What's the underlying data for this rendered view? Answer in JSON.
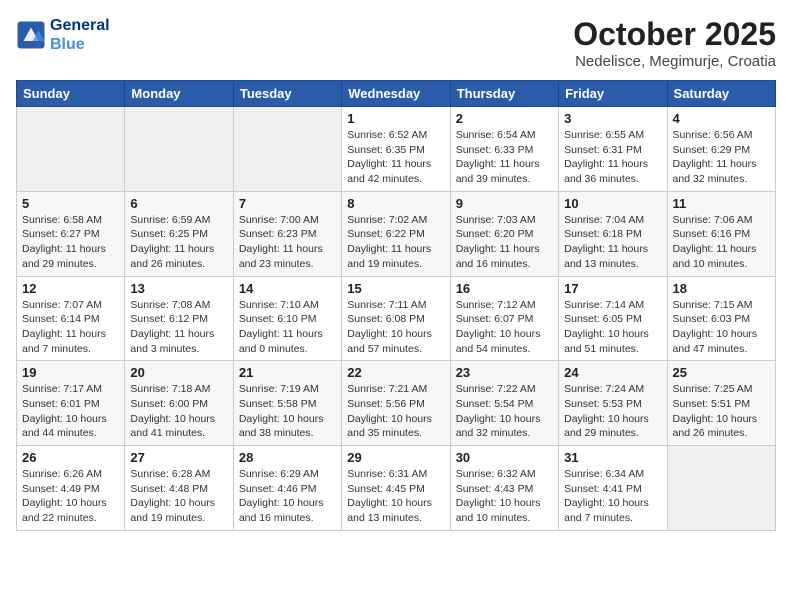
{
  "header": {
    "logo_line1": "General",
    "logo_line2": "Blue",
    "title": "October 2025",
    "subtitle": "Nedelisce, Megimurje, Croatia"
  },
  "calendar": {
    "days_of_week": [
      "Sunday",
      "Monday",
      "Tuesday",
      "Wednesday",
      "Thursday",
      "Friday",
      "Saturday"
    ],
    "weeks": [
      [
        {
          "day": "",
          "info": ""
        },
        {
          "day": "",
          "info": ""
        },
        {
          "day": "",
          "info": ""
        },
        {
          "day": "1",
          "info": "Sunrise: 6:52 AM\nSunset: 6:35 PM\nDaylight: 11 hours\nand 42 minutes."
        },
        {
          "day": "2",
          "info": "Sunrise: 6:54 AM\nSunset: 6:33 PM\nDaylight: 11 hours\nand 39 minutes."
        },
        {
          "day": "3",
          "info": "Sunrise: 6:55 AM\nSunset: 6:31 PM\nDaylight: 11 hours\nand 36 minutes."
        },
        {
          "day": "4",
          "info": "Sunrise: 6:56 AM\nSunset: 6:29 PM\nDaylight: 11 hours\nand 32 minutes."
        }
      ],
      [
        {
          "day": "5",
          "info": "Sunrise: 6:58 AM\nSunset: 6:27 PM\nDaylight: 11 hours\nand 29 minutes."
        },
        {
          "day": "6",
          "info": "Sunrise: 6:59 AM\nSunset: 6:25 PM\nDaylight: 11 hours\nand 26 minutes."
        },
        {
          "day": "7",
          "info": "Sunrise: 7:00 AM\nSunset: 6:23 PM\nDaylight: 11 hours\nand 23 minutes."
        },
        {
          "day": "8",
          "info": "Sunrise: 7:02 AM\nSunset: 6:22 PM\nDaylight: 11 hours\nand 19 minutes."
        },
        {
          "day": "9",
          "info": "Sunrise: 7:03 AM\nSunset: 6:20 PM\nDaylight: 11 hours\nand 16 minutes."
        },
        {
          "day": "10",
          "info": "Sunrise: 7:04 AM\nSunset: 6:18 PM\nDaylight: 11 hours\nand 13 minutes."
        },
        {
          "day": "11",
          "info": "Sunrise: 7:06 AM\nSunset: 6:16 PM\nDaylight: 11 hours\nand 10 minutes."
        }
      ],
      [
        {
          "day": "12",
          "info": "Sunrise: 7:07 AM\nSunset: 6:14 PM\nDaylight: 11 hours\nand 7 minutes."
        },
        {
          "day": "13",
          "info": "Sunrise: 7:08 AM\nSunset: 6:12 PM\nDaylight: 11 hours\nand 3 minutes."
        },
        {
          "day": "14",
          "info": "Sunrise: 7:10 AM\nSunset: 6:10 PM\nDaylight: 11 hours\nand 0 minutes."
        },
        {
          "day": "15",
          "info": "Sunrise: 7:11 AM\nSunset: 6:08 PM\nDaylight: 10 hours\nand 57 minutes."
        },
        {
          "day": "16",
          "info": "Sunrise: 7:12 AM\nSunset: 6:07 PM\nDaylight: 10 hours\nand 54 minutes."
        },
        {
          "day": "17",
          "info": "Sunrise: 7:14 AM\nSunset: 6:05 PM\nDaylight: 10 hours\nand 51 minutes."
        },
        {
          "day": "18",
          "info": "Sunrise: 7:15 AM\nSunset: 6:03 PM\nDaylight: 10 hours\nand 47 minutes."
        }
      ],
      [
        {
          "day": "19",
          "info": "Sunrise: 7:17 AM\nSunset: 6:01 PM\nDaylight: 10 hours\nand 44 minutes."
        },
        {
          "day": "20",
          "info": "Sunrise: 7:18 AM\nSunset: 6:00 PM\nDaylight: 10 hours\nand 41 minutes."
        },
        {
          "day": "21",
          "info": "Sunrise: 7:19 AM\nSunset: 5:58 PM\nDaylight: 10 hours\nand 38 minutes."
        },
        {
          "day": "22",
          "info": "Sunrise: 7:21 AM\nSunset: 5:56 PM\nDaylight: 10 hours\nand 35 minutes."
        },
        {
          "day": "23",
          "info": "Sunrise: 7:22 AM\nSunset: 5:54 PM\nDaylight: 10 hours\nand 32 minutes."
        },
        {
          "day": "24",
          "info": "Sunrise: 7:24 AM\nSunset: 5:53 PM\nDaylight: 10 hours\nand 29 minutes."
        },
        {
          "day": "25",
          "info": "Sunrise: 7:25 AM\nSunset: 5:51 PM\nDaylight: 10 hours\nand 26 minutes."
        }
      ],
      [
        {
          "day": "26",
          "info": "Sunrise: 6:26 AM\nSunset: 4:49 PM\nDaylight: 10 hours\nand 22 minutes."
        },
        {
          "day": "27",
          "info": "Sunrise: 6:28 AM\nSunset: 4:48 PM\nDaylight: 10 hours\nand 19 minutes."
        },
        {
          "day": "28",
          "info": "Sunrise: 6:29 AM\nSunset: 4:46 PM\nDaylight: 10 hours\nand 16 minutes."
        },
        {
          "day": "29",
          "info": "Sunrise: 6:31 AM\nSunset: 4:45 PM\nDaylight: 10 hours\nand 13 minutes."
        },
        {
          "day": "30",
          "info": "Sunrise: 6:32 AM\nSunset: 4:43 PM\nDaylight: 10 hours\nand 10 minutes."
        },
        {
          "day": "31",
          "info": "Sunrise: 6:34 AM\nSunset: 4:41 PM\nDaylight: 10 hours\nand 7 minutes."
        },
        {
          "day": "",
          "info": ""
        }
      ]
    ]
  }
}
